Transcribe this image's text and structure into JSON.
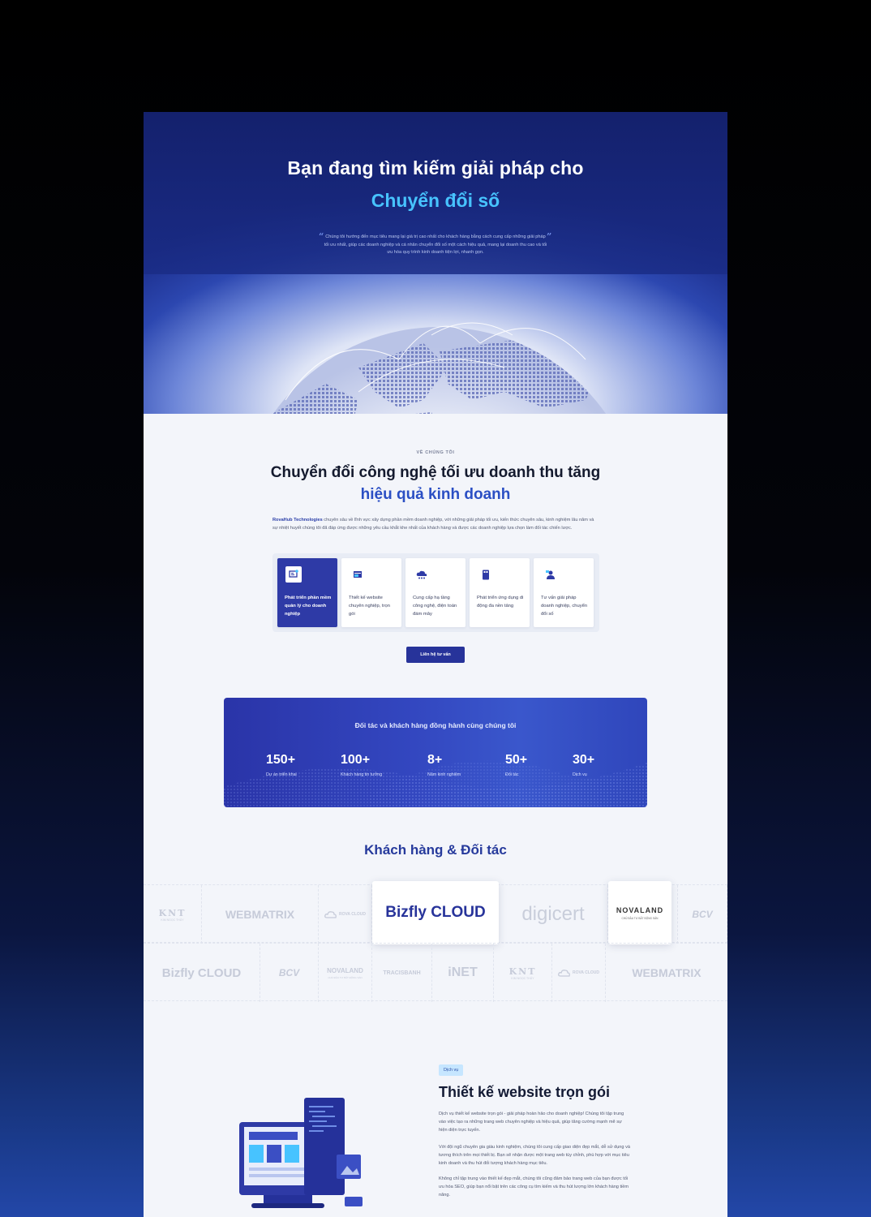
{
  "hero": {
    "title_line1": "Bạn đang tìm kiếm giải pháp cho",
    "title_line2": "Chuyển đổi số",
    "quote": "Chúng tôi hướng đến mục tiêu mang lại giá trị cao nhất cho khách hàng bằng cách cung cấp những giải pháp tối ưu nhất, giúp các doanh nghiệp và cá nhân chuyển đổi số một cách hiệu quả, mang lại doanh thu cao và tối ưu hóa quy trình kinh doanh tiện lợi, nhanh gọn."
  },
  "about": {
    "kicker": "VỀ CHÚNG TÔI",
    "title_line1": "Chuyển đổi công nghệ tối ưu doanh thu tăng",
    "title_line2": "hiệu quả kinh doanh",
    "brand": "RovaHub Technologies",
    "paragraph": " chuyên sâu về lĩnh vực xây dựng phần mềm doanh nghiệp, với những giải pháp tối ưu, kiến thức chuyên sâu, kinh nghiệm lâu năm và sự nhiệt huyết chúng tôi đã đáp ứng được những yêu cầu khắt khe nhất của khách hàng và được các doanh nghiệp lựa chọn làm đối tác chiến lược.",
    "services": [
      {
        "label": "Phát triển phần mềm quản lý cho doanh nghiệp",
        "icon": "software-icon",
        "active": true
      },
      {
        "label": "Thiết kế website chuyên nghiệp, trọn gói",
        "icon": "website-icon",
        "active": false
      },
      {
        "label": "Cung cấp hạ tầng công nghệ, điện toán đám mây",
        "icon": "cloud-icon",
        "active": false
      },
      {
        "label": "Phát triển ứng dụng di động đa nền tảng",
        "icon": "mobile-icon",
        "active": false
      },
      {
        "label": "Tư vấn giải pháp doanh nghiệp, chuyển đổi số",
        "icon": "consult-icon",
        "active": false
      }
    ],
    "cta_label": "Liên hệ tư vấn"
  },
  "stats": {
    "title": "Đối tác và khách hàng đồng hành cùng chúng tôi",
    "items": [
      {
        "value": "150+",
        "label": "Dự án triển khai"
      },
      {
        "value": "100+",
        "label": "Khách hàng tin tưởng"
      },
      {
        "value": "8+",
        "label": "Năm kinh nghiệm"
      },
      {
        "value": "50+",
        "label": "Đối tác"
      },
      {
        "value": "30+",
        "label": "Dịch vụ"
      }
    ]
  },
  "partners": {
    "title": "Khách hàng & Đối tác",
    "row1": [
      "KNT",
      "WEBMATRIX",
      "ROVA CLOUD",
      "Bizfly CLOUD",
      "digicert",
      "NOVALAND",
      "BCV"
    ],
    "row2": [
      "Bizfly CLOUD",
      "BCV",
      "NOVALAND",
      "TRACISBANH",
      "iNET",
      "KNT",
      "ROVA CLOUD",
      "WEBMATRIX"
    ],
    "knt_sub": "KIM NGỌC THỦY",
    "rova_sub": "ROVA CLOUD",
    "novaland_sub": "CHỦ ĐẦU TƯ BẤT ĐỘNG SẢN"
  },
  "service_section": {
    "tag": "Dịch vụ",
    "title": "Thiết kế website trọn gói",
    "p1": "Dịch vụ thiết kế website trọn gói - giải pháp hoàn hảo cho doanh nghiệp! Chúng tôi tập trung vào việc tạo ra những trang web chuyên nghiệp và hiệu quả, giúp tăng cường mạnh mẽ sự hiện diện trực tuyến.",
    "p2": "Với đội ngũ chuyên gia giàu kinh nghiệm, chúng tôi cung cấp giao diện đẹp mắt, dễ sử dụng và tương thích trên mọi thiết bị. Bạn sẽ nhận được một trang web tùy chỉnh, phù hợp với mục tiêu kinh doanh và thu hút đối tượng khách hàng mục tiêu.",
    "p3": "Không chỉ tập trung vào thiết kế đẹp mắt, chúng tôi cũng đảm bảo trang web của bạn được tối ưu hóa SEO, giúp bạn nổi bật trên các công cụ tìm kiếm và thu hút lượng lớn khách hàng tiềm năng."
  },
  "colors": {
    "primary": "#27339a",
    "accent": "#47c3ff",
    "heading": "#263a9c"
  }
}
